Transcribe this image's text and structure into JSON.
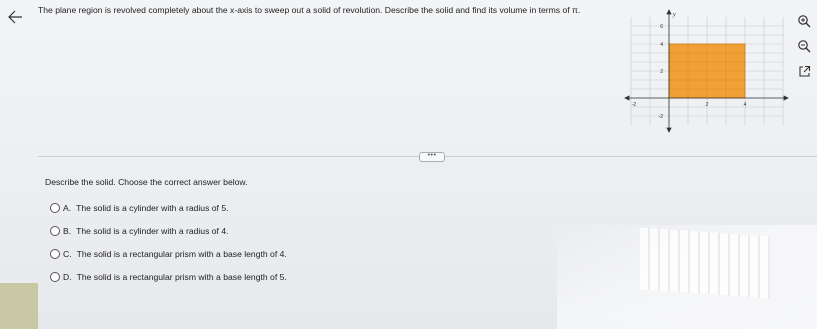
{
  "question": {
    "text": "The plane region is revolved completely about the x-axis to sweep out a solid of revolution. Describe the solid and find its volume in terms of π."
  },
  "graph": {
    "axis_labels": {
      "y": "y"
    },
    "y_ticks": [
      "6",
      "4",
      "2",
      "-2"
    ],
    "x_ticks": [
      "-2",
      "2",
      "4"
    ],
    "region": {
      "x": [
        0,
        4
      ],
      "y": [
        0,
        4
      ]
    },
    "region_color": "#f0a035"
  },
  "tools": {
    "icons": [
      "zoom-in-icon",
      "zoom-out-icon",
      "external-link-icon"
    ]
  },
  "more_handle": {
    "label": "•••"
  },
  "prompt": {
    "text": "Describe the solid. Choose the correct answer below."
  },
  "choices": [
    {
      "letter": "A.",
      "text": "The solid is a cylinder with a radius of 5."
    },
    {
      "letter": "B.",
      "text": "The solid is a cylinder with a radius of 4."
    },
    {
      "letter": "C.",
      "text": "The solid is a rectangular prism with a base length of 4."
    },
    {
      "letter": "D.",
      "text": "The solid is a rectangular prism with a base length of 5."
    }
  ]
}
